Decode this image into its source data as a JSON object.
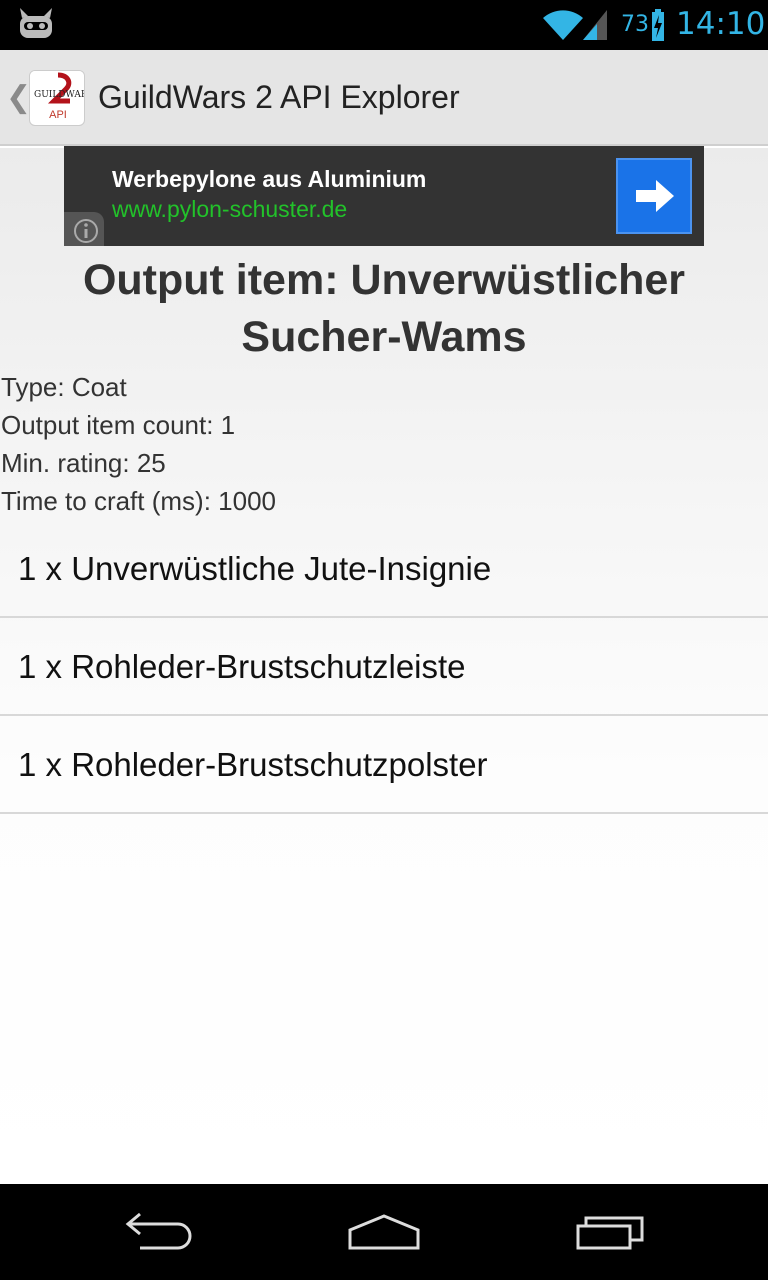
{
  "status_bar": {
    "battery_percent": "73",
    "time": "14:10",
    "accent_color": "#33b5e5"
  },
  "action_bar": {
    "title": "GuildWars 2 API Explorer",
    "icon_label": "API"
  },
  "ad": {
    "title": "Werbepylone aus Aluminium",
    "url": "www.pylon-schuster.de"
  },
  "recipe": {
    "heading": "Output item: Unverwüstlicher Sucher-Wams",
    "type": "Type: Coat",
    "output_count": "Output item count: 1",
    "min_rating": "Min. rating: 25",
    "time_to_craft": "Time to craft (ms): 1000",
    "ingredients": [
      "1 x Unverwüstliche Jute-Insignie",
      "1 x Rohleder-Brustschutzleiste",
      "1 x Rohleder-Brustschutzpolster"
    ]
  }
}
